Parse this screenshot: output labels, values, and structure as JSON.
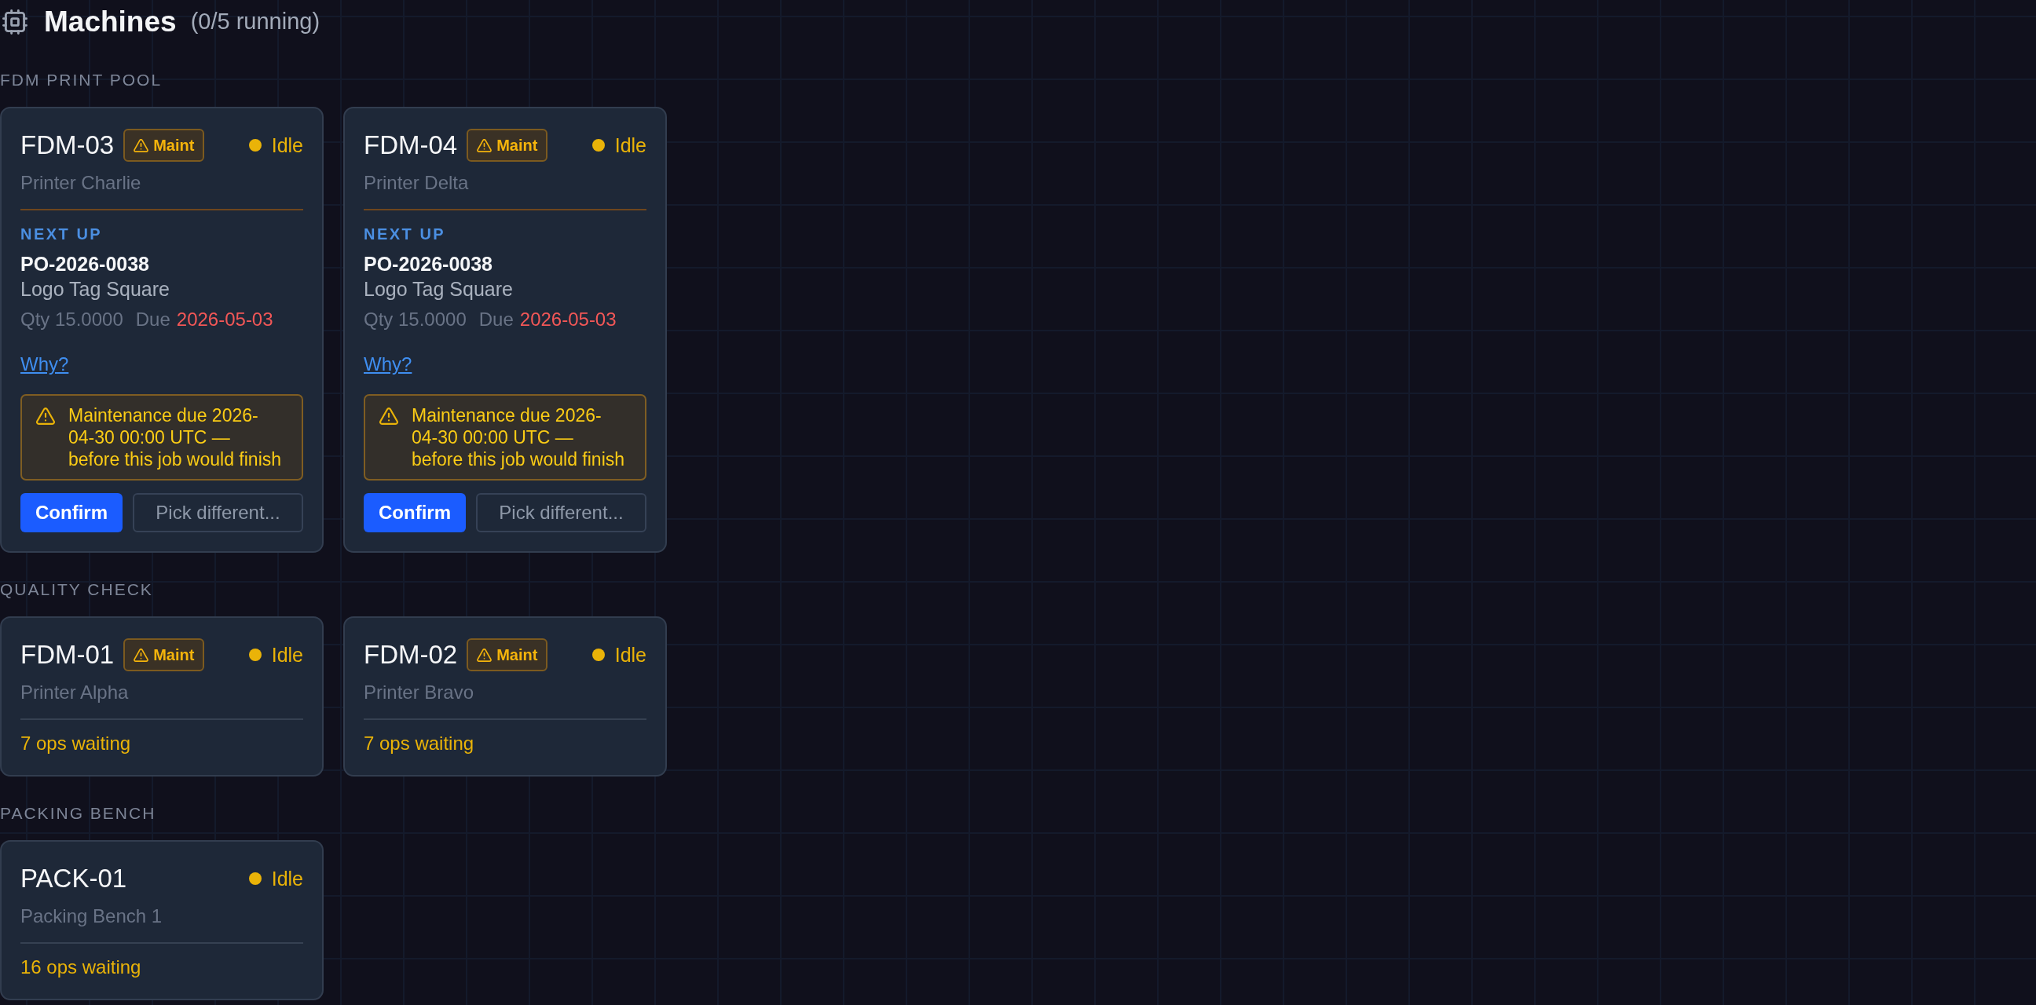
{
  "header": {
    "title": "Machines",
    "summary": "(0/5 running)"
  },
  "groups": [
    {
      "label": "FDM PRINT POOL",
      "machines": [
        {
          "code": "FDM-03",
          "badge": "Maint",
          "status": {
            "label": "Idle",
            "color": "#eab308"
          },
          "name": "Printer Charlie",
          "next_up": {
            "heading": "NEXT UP",
            "order": "PO-2026-0038",
            "product": "Logo Tag Square",
            "qty": "Qty 15.0000",
            "due_label": "Due",
            "due": "2026-05-03",
            "due_urgent": true,
            "link": "Why?",
            "warning": "Maintenance due 2026-04-30 00:00 UTC — before this job would finish",
            "actions": [
              {
                "label": "Confirm",
                "kind": "primary"
              },
              {
                "label": "Pick different...",
                "kind": "secondary"
              }
            ]
          }
        },
        {
          "code": "FDM-04",
          "badge": "Maint",
          "status": {
            "label": "Idle",
            "color": "#eab308"
          },
          "name": "Printer Delta",
          "next_up": {
            "heading": "NEXT UP",
            "order": "PO-2026-0038",
            "product": "Logo Tag Square",
            "qty": "Qty 15.0000",
            "due_label": "Due",
            "due": "2026-05-03",
            "due_urgent": true,
            "link": "Why?",
            "warning": "Maintenance due 2026-04-30 00:00 UTC — before this job would finish",
            "actions": [
              {
                "label": "Confirm",
                "kind": "primary"
              },
              {
                "label": "Pick different...",
                "kind": "secondary"
              }
            ]
          }
        }
      ]
    },
    {
      "label": "QUALITY CHECK",
      "machines": [
        {
          "code": "FDM-01",
          "badge": "Maint",
          "status": {
            "label": "Idle",
            "color": "#eab308"
          },
          "name": "Printer Alpha",
          "waiting": "7 ops waiting"
        },
        {
          "code": "FDM-02",
          "badge": "Maint",
          "status": {
            "label": "Idle",
            "color": "#eab308"
          },
          "name": "Printer Bravo",
          "waiting": "7 ops waiting"
        }
      ]
    },
    {
      "label": "PACKING BENCH",
      "machines": [
        {
          "code": "PACK-01",
          "status": {
            "label": "Idle",
            "color": "#eab308"
          },
          "name": "Packing Bench 1",
          "waiting": "16 ops waiting"
        }
      ]
    }
  ]
}
